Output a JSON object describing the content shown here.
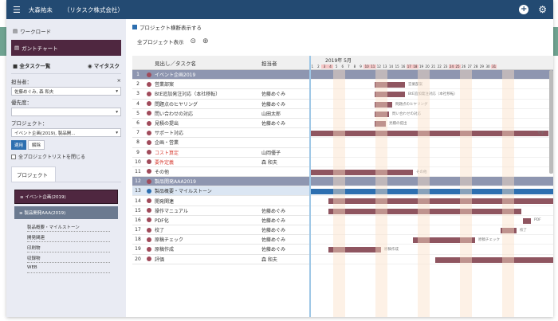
{
  "topbar": {
    "user": "大森祐未",
    "company": "（リタスク株式会社）"
  },
  "sidebar": {
    "workload": "ワークロード",
    "gantt": "ガントチャート",
    "all_tasks": "全タスク一覧",
    "my_tasks": "マイタスク",
    "assignee_label": "担当者：",
    "assignee_value": "佐藤めぐみ, 森 和夫",
    "priority_label": "優先度：",
    "project_label": "プロジェクト：",
    "project_value": "イベント企画(2019), 製品開...",
    "apply": "適用",
    "clear": "解除",
    "close_all": "全プロジェクトリストを閉じる",
    "project_tab": "プロジェクト",
    "project_event": "イベント企画(2019)",
    "project_product": "製品開発AAA(2019)",
    "sub_items": [
      "製品概要・マイルストーン",
      "開発関連",
      "印刷物",
      "収録物",
      "WEB"
    ]
  },
  "main": {
    "show_name_option": "プロジェクト横断表示する",
    "all_projects": "全プロジェクト表示",
    "col_title": "見出し／タスク名",
    "col_owner": "担当者",
    "month": "2019年 5月",
    "days": [
      "1",
      "2",
      "3",
      "4",
      "5",
      "6",
      "7",
      "8",
      "9",
      "10",
      "11",
      "12",
      "13",
      "14",
      "15",
      "16",
      "17",
      "18",
      "19",
      "20",
      "21",
      "22",
      "23",
      "24",
      "25",
      "26",
      "27",
      "28",
      "29",
      "30",
      "31"
    ],
    "rows": [
      {
        "num": "1",
        "title": "イベント企画2019",
        "owner": "",
        "style": "hl",
        "bar_label": ""
      },
      {
        "num": "2",
        "title": "営業部案",
        "owner": "",
        "style": "",
        "bar_label": "営業部案"
      },
      {
        "num": "3",
        "title": "BtE追加発注対応（本社移転）",
        "owner": "佐藤めぐみ",
        "style": "",
        "bar_label": "BtE追加発注対応（本社移転）"
      },
      {
        "num": "4",
        "title": "問題点のヒヤリング",
        "owner": "佐藤めぐみ",
        "style": "",
        "bar_label": "問題点のヒヤリング"
      },
      {
        "num": "5",
        "title": "問い合わせの対応",
        "owner": "山田太郎",
        "style": "",
        "bar_label": "問い合わせの対応"
      },
      {
        "num": "6",
        "title": "見積の提出",
        "owner": "佐藤めぐみ",
        "style": "",
        "bar_label": "見積の提出"
      },
      {
        "num": "7",
        "title": "サポート対応",
        "owner": "",
        "style": "",
        "bar_label": "サポ"
      },
      {
        "num": "8",
        "title": "企画・営業",
        "owner": "",
        "style": "",
        "bar_label": ""
      },
      {
        "num": "9",
        "title": "コスト算定",
        "owner": "山岡優子",
        "style": "red",
        "bar_label": ""
      },
      {
        "num": "10",
        "title": "要件定義",
        "owner": "森 和夫",
        "style": "red",
        "bar_label": ""
      },
      {
        "num": "11",
        "title": "その他",
        "owner": "",
        "style": "",
        "bar_label": "その他"
      },
      {
        "num": "12",
        "title": "製品開発AAA2019",
        "owner": "",
        "style": "hl",
        "bar_label": ""
      },
      {
        "num": "13",
        "title": "製品概要・マイルストーン",
        "owner": "",
        "style": "sel",
        "bar_label": ""
      },
      {
        "num": "14",
        "title": "開発関連",
        "owner": "",
        "style": "",
        "bar_label": ""
      },
      {
        "num": "15",
        "title": "操作マニュアル",
        "owner": "佐藤めぐみ",
        "style": "",
        "bar_label": ""
      },
      {
        "num": "16",
        "title": "PDF化",
        "owner": "佐藤めぐみ",
        "style": "",
        "bar_label": "PDF"
      },
      {
        "num": "17",
        "title": "校了",
        "owner": "佐藤めぐみ",
        "style": "",
        "bar_label": "校了"
      },
      {
        "num": "18",
        "title": "原稿チェック",
        "owner": "佐藤めぐみ",
        "style": "",
        "bar_label": "原稿チェック"
      },
      {
        "num": "19",
        "title": "原稿作成",
        "owner": "佐藤めぐみ",
        "style": "",
        "bar_label": "原稿作成"
      },
      {
        "num": "20",
        "title": "評価",
        "owner": "森 和夫",
        "style": "",
        "bar_label": ""
      }
    ]
  }
}
